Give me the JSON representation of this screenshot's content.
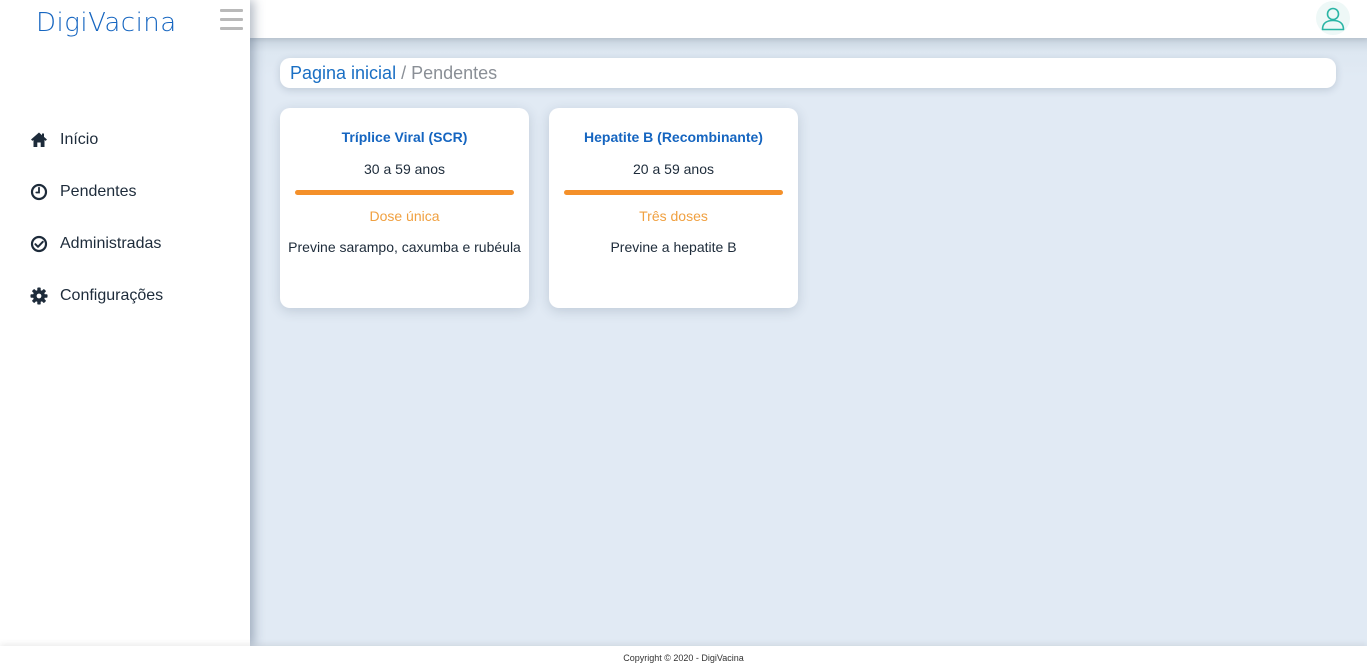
{
  "app": {
    "brand": "DigiVacina"
  },
  "sidebar": {
    "items": [
      {
        "label": "Início",
        "icon": "home-icon"
      },
      {
        "label": "Pendentes",
        "icon": "clock-icon"
      },
      {
        "label": "Administradas",
        "icon": "check-circle-icon"
      },
      {
        "label": "Configurações",
        "icon": "gear-icon"
      }
    ]
  },
  "topbar": {
    "avatar_icon": "user-icon"
  },
  "breadcrumb": {
    "home": "Pagina inicial",
    "separator": "/",
    "current": "Pendentes"
  },
  "cards": [
    {
      "title": "Tríplice Viral (SCR)",
      "age": "30 a 59 anos",
      "dose": "Dose única",
      "description": "Previne sarampo, caxumba e rubéula"
    },
    {
      "title": "Hepatite B (Recombinante)",
      "age": "20 a 59 anos",
      "dose": "Três doses",
      "description": "Previne a hepatite B"
    }
  ],
  "footer": {
    "text": "Copyright © 2020 - DigiVacina"
  },
  "colors": {
    "brand": "#1565c0",
    "accent_orange": "#f4902a",
    "dose_text": "#f0a040",
    "background": "#e1eaf4",
    "nav_text": "#1d2b3a"
  }
}
